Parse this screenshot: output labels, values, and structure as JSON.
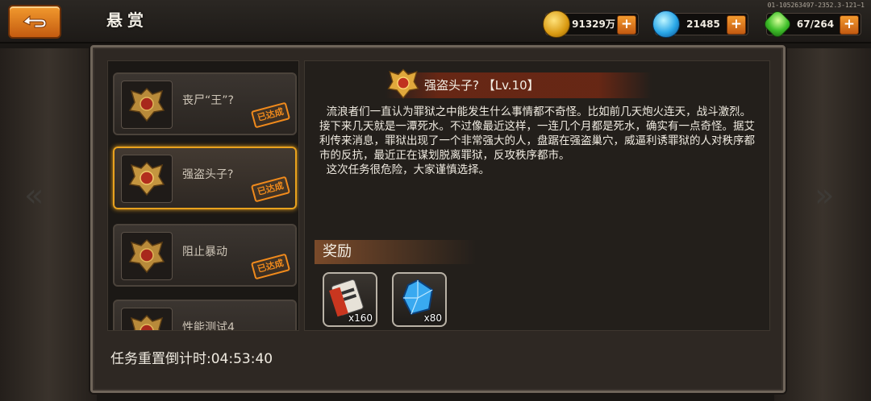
{
  "header": {
    "title": "悬赏",
    "build_id": "01-105263497-2352.3-121~1"
  },
  "resources": [
    {
      "icon": "gold-coin-icon",
      "value": "91329万"
    },
    {
      "icon": "blue-gem-icon",
      "value": "21485"
    },
    {
      "icon": "green-energy-icon",
      "value": "67/264"
    }
  ],
  "bounties": [
    {
      "name": "丧尸“王”?",
      "status": "已达成"
    },
    {
      "name": "强盗头子?",
      "status": "已达成"
    },
    {
      "name": "阻止暴动",
      "status": "已达成"
    },
    {
      "name": "性能测试4",
      "status": ""
    }
  ],
  "detail": {
    "title": "强盗头子? 【Lv.10】",
    "description": "  流浪者们一直认为罪狱之中能发生什么事情都不奇怪。比如前几天炮火连天，战斗激烈。接下来几天就是一潭死水。不过像最近这样，一连几个月都是死水，确实有一点奇怪。据艾利传来消息，罪狱出现了一个非常强大的人，盘踞在强盗巢穴，威逼利诱罪狱的人对秩序都市的反抗，最近正在谋划脱离罪狱，反攻秩序都市。\n  这次任务很危险，大家谨慎选择。",
    "reward_label": "奖励",
    "rewards": [
      {
        "icon": "ticket-scroll-icon",
        "qty": "x160"
      },
      {
        "icon": "blue-crystal-icon",
        "qty": "x80"
      }
    ]
  },
  "timer": "任务重置倒计时:04:53:40",
  "colors": {
    "accent": "#e9a21e",
    "stamp": "#f08a1c",
    "button": "#e07a20"
  }
}
